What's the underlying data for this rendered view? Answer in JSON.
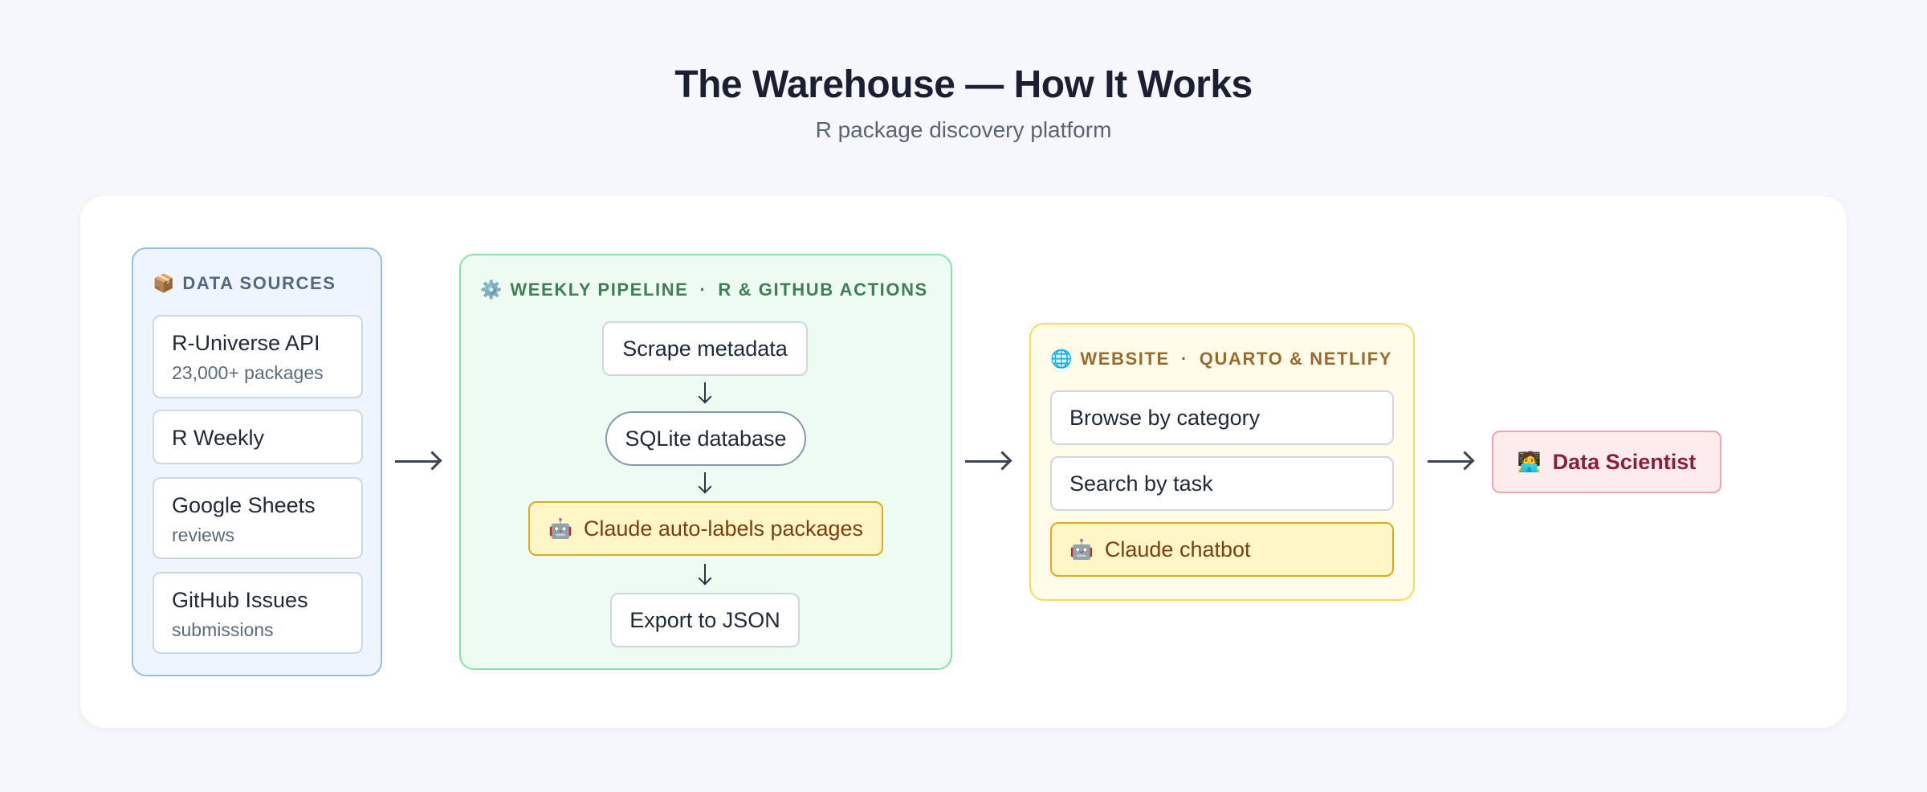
{
  "header": {
    "title": "The Warehouse — How It Works",
    "subtitle": "R package discovery platform"
  },
  "sources": {
    "icon": "package-icon",
    "icon_glyph": "📦",
    "title": "DATA SOURCES",
    "items": [
      {
        "label": "R-Universe API",
        "sub": "23,000+ packages"
      },
      {
        "label": "R Weekly",
        "sub": ""
      },
      {
        "label": "Google Sheets",
        "sub": "reviews"
      },
      {
        "label": "GitHub Issues",
        "sub": "submissions"
      }
    ]
  },
  "pipeline": {
    "icon": "gear-icon",
    "icon_glyph": "⚙️",
    "title": "WEEKLY PIPELINE",
    "separator": "·",
    "tech": "R & GITHUB ACTIONS",
    "steps": [
      {
        "label": "Scrape metadata"
      },
      {
        "label": "SQLite database"
      },
      {
        "label": "Claude auto-labels packages",
        "icon": "robot-icon",
        "icon_glyph": "🤖"
      },
      {
        "label": "Export to JSON"
      }
    ]
  },
  "website": {
    "icon": "globe-icon",
    "icon_glyph": "🌐",
    "title": "WEBSITE",
    "separator": "·",
    "tech": "QUARTO & NETLIFY",
    "items": [
      {
        "label": "Browse by category"
      },
      {
        "label": "Search by task"
      },
      {
        "label": "Claude chatbot",
        "icon": "robot-icon",
        "icon_glyph": "🤖"
      }
    ]
  },
  "user": {
    "icon": "scientist-icon",
    "icon_glyph": "🧑‍💻",
    "label": "Data Scientist"
  },
  "colors": {
    "sources_accent": "#8fc0ee",
    "pipeline_accent": "#86e3a6",
    "website_accent": "#f4dc57",
    "claude_accent": "#e3a81d",
    "user_accent": "#f2a3b0"
  }
}
